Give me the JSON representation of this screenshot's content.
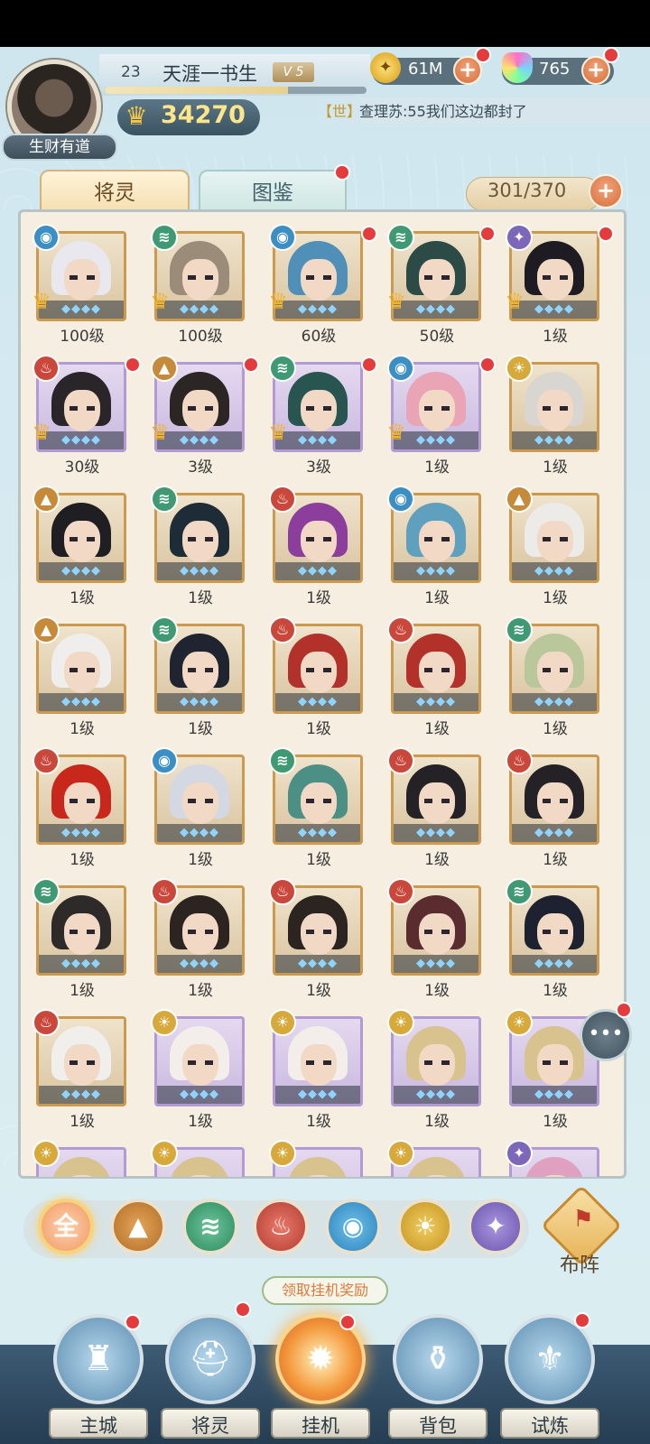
{
  "header": {
    "player_level": "23",
    "player_name": "天涯一书生",
    "vip_level": "V 5",
    "avatar_title": "生财有道",
    "power": "34270",
    "exp_progress": 0.7,
    "gold": "61M",
    "gems": "765"
  },
  "chat": {
    "channel": "【世】",
    "message": "查理苏:55我们这边都封了"
  },
  "tabs": [
    {
      "label": "将灵",
      "selected": true
    },
    {
      "label": "图鉴",
      "selected": false
    }
  ],
  "capacity": "301/370",
  "elements": {
    "water": "水",
    "wind": "风",
    "fire": "火",
    "earth": "土",
    "light": "光",
    "dark": "暗"
  },
  "heroes": [
    {
      "element": "water",
      "level": "100级",
      "frame": "gold",
      "crown": true,
      "dot": false,
      "hair": "#e8e8ee"
    },
    {
      "element": "wind",
      "level": "100级",
      "frame": "gold",
      "crown": true,
      "dot": false,
      "hair": "#9b8c7a"
    },
    {
      "element": "water",
      "level": "60级",
      "frame": "gold",
      "crown": true,
      "dot": true,
      "hair": "#4f8fb8"
    },
    {
      "element": "wind",
      "level": "50级",
      "frame": "gold",
      "crown": true,
      "dot": true,
      "hair": "#2c4a46"
    },
    {
      "element": "dark",
      "level": "1级",
      "frame": "gold",
      "crown": true,
      "dot": true,
      "hair": "#1e1c22"
    },
    {
      "element": "fire",
      "level": "30级",
      "frame": "purple",
      "crown": true,
      "dot": true,
      "hair": "#2a2528"
    },
    {
      "element": "earth",
      "level": "3级",
      "frame": "purple",
      "crown": true,
      "dot": true,
      "hair": "#2b2624"
    },
    {
      "element": "wind",
      "level": "3级",
      "frame": "purple",
      "crown": true,
      "dot": true,
      "hair": "#285550"
    },
    {
      "element": "water",
      "level": "1级",
      "frame": "purple",
      "crown": true,
      "dot": true,
      "hair": "#e9a4b5"
    },
    {
      "element": "light",
      "level": "1级",
      "frame": "gold",
      "crown": false,
      "dot": false,
      "hair": "#d9d6d2"
    },
    {
      "element": "earth",
      "level": "1级",
      "frame": "gold",
      "crown": false,
      "dot": false,
      "hair": "#1f1e22"
    },
    {
      "element": "wind",
      "level": "1级",
      "frame": "gold",
      "crown": false,
      "dot": false,
      "hair": "#1e2c38"
    },
    {
      "element": "fire",
      "level": "1级",
      "frame": "gold",
      "crown": false,
      "dot": false,
      "hair": "#8c3e9c"
    },
    {
      "element": "water",
      "level": "1级",
      "frame": "gold",
      "crown": false,
      "dot": false,
      "hair": "#5fa0bf"
    },
    {
      "element": "earth",
      "level": "1级",
      "frame": "gold",
      "crown": false,
      "dot": false,
      "hair": "#ecebe8"
    },
    {
      "element": "earth",
      "level": "1级",
      "frame": "gold",
      "crown": false,
      "dot": false,
      "hair": "#efeeec"
    },
    {
      "element": "wind",
      "level": "1级",
      "frame": "gold",
      "crown": false,
      "dot": false,
      "hair": "#1f2430"
    },
    {
      "element": "fire",
      "level": "1级",
      "frame": "gold",
      "crown": false,
      "dot": false,
      "hair": "#b2312a"
    },
    {
      "element": "fire",
      "level": "1级",
      "frame": "gold",
      "crown": false,
      "dot": false,
      "hair": "#b2312a"
    },
    {
      "element": "wind",
      "level": "1级",
      "frame": "gold",
      "crown": false,
      "dot": false,
      "hair": "#b9c79a"
    },
    {
      "element": "fire",
      "level": "1级",
      "frame": "gold",
      "crown": false,
      "dot": false,
      "hair": "#c8281c"
    },
    {
      "element": "water",
      "level": "1级",
      "frame": "gold",
      "crown": false,
      "dot": false,
      "hair": "#d4d8e2"
    },
    {
      "element": "wind",
      "level": "1级",
      "frame": "gold",
      "crown": false,
      "dot": false,
      "hair": "#4b8f85"
    },
    {
      "element": "fire",
      "level": "1级",
      "frame": "gold",
      "crown": false,
      "dot": false,
      "hair": "#242226"
    },
    {
      "element": "fire",
      "level": "1级",
      "frame": "gold",
      "crown": false,
      "dot": false,
      "hair": "#242226"
    },
    {
      "element": "wind",
      "level": "1级",
      "frame": "gold",
      "crown": false,
      "dot": false,
      "hair": "#2e2a2a"
    },
    {
      "element": "fire",
      "level": "1级",
      "frame": "gold",
      "crown": false,
      "dot": false,
      "hair": "#2c2420"
    },
    {
      "element": "fire",
      "level": "1级",
      "frame": "gold",
      "crown": false,
      "dot": false,
      "hair": "#2c2420"
    },
    {
      "element": "fire",
      "level": "1级",
      "frame": "gold",
      "crown": false,
      "dot": false,
      "hair": "#5a2c30"
    },
    {
      "element": "wind",
      "level": "1级",
      "frame": "gold",
      "crown": false,
      "dot": false,
      "hair": "#1e2230"
    },
    {
      "element": "fire",
      "level": "1级",
      "frame": "gold",
      "crown": false,
      "dot": false,
      "hair": "#f1efec"
    },
    {
      "element": "light",
      "level": "1级",
      "frame": "purple",
      "crown": false,
      "dot": false,
      "hair": "#f3eeea"
    },
    {
      "element": "light",
      "level": "1级",
      "frame": "purple",
      "crown": false,
      "dot": false,
      "hair": "#f3eeea"
    },
    {
      "element": "light",
      "level": "1级",
      "frame": "purple",
      "crown": false,
      "dot": false,
      "hair": "#d8c28e"
    },
    {
      "element": "light",
      "level": "1级",
      "frame": "purple",
      "crown": false,
      "dot": false,
      "hair": "#d8c28e"
    },
    {
      "element": "light",
      "level": "",
      "frame": "purple",
      "crown": false,
      "dot": false,
      "hair": "#d8c28e"
    },
    {
      "element": "light",
      "level": "",
      "frame": "purple",
      "crown": false,
      "dot": false,
      "hair": "#d8c28e"
    },
    {
      "element": "light",
      "level": "",
      "frame": "purple",
      "crown": false,
      "dot": false,
      "hair": "#d8c28e"
    },
    {
      "element": "light",
      "level": "",
      "frame": "purple",
      "crown": false,
      "dot": false,
      "hair": "#d8c28e"
    },
    {
      "element": "dark",
      "level": "",
      "frame": "purple",
      "crown": false,
      "dot": false,
      "hair": "#e0a0c0"
    }
  ],
  "filters": {
    "all": "全",
    "selected": "all",
    "icons": [
      "earth-icon",
      "wind-icon",
      "fire-icon",
      "water-icon",
      "light-icon",
      "dark-icon"
    ]
  },
  "formation_label": "布阵",
  "idle_reward_tip": "领取挂机奖励",
  "nav": {
    "main_city": "主城",
    "heroes": "将灵",
    "idle": "挂机",
    "bag": "背包",
    "trial": "试炼"
  },
  "colors": {
    "gold_frame": "#cc9a4e",
    "purple_frame": "#b49ad4",
    "red_dot": "#e43c3c",
    "power_text": "#ffe68a"
  }
}
